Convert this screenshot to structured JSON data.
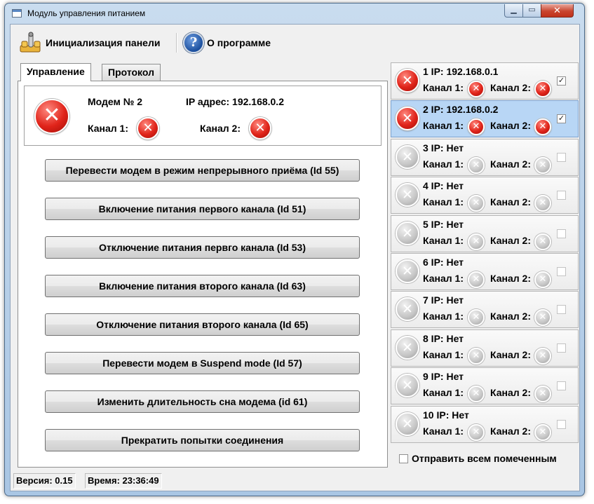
{
  "window": {
    "title": "Модуль управления питанием"
  },
  "toolbar": {
    "init_label": "Инициализация панели",
    "about_label": "О программе"
  },
  "tabs": [
    "Управление",
    "Протокол"
  ],
  "status": {
    "modem_label": "Модем № 2",
    "ip_label": "IP адрес: 192.168.0.2",
    "ch1_label": "Канал 1:",
    "ch2_label": "Канал 2:"
  },
  "buttons": [
    "Перевести модем в режим непрерывного приёма (Id 55)",
    "Включение питания первого канала (Id 51)",
    "Отключение питания первго канала (Id 53)",
    "Включение питания второго канала (Id 63)",
    "Отключение питания второго канала (Id 65)",
    "Перевести модем в Suspend mode (Id 57)",
    "Изменить длительность сна модема (id 61)",
    "Прекратить попытки соединения"
  ],
  "modems": [
    {
      "ip": "1 IP: 192.168.0.1",
      "state": "error",
      "checked": true,
      "selected": false
    },
    {
      "ip": "2 IP: 192.168.0.2",
      "state": "error",
      "checked": true,
      "selected": true
    },
    {
      "ip": "3 IP: Нет",
      "state": "off",
      "checked": false,
      "selected": false
    },
    {
      "ip": "4 IP: Нет",
      "state": "off",
      "checked": false,
      "selected": false
    },
    {
      "ip": "5 IP: Нет",
      "state": "off",
      "checked": false,
      "selected": false
    },
    {
      "ip": "6 IP: Нет",
      "state": "off",
      "checked": false,
      "selected": false
    },
    {
      "ip": "7 IP: Нет",
      "state": "off",
      "checked": false,
      "selected": false
    },
    {
      "ip": "8 IP: Нет",
      "state": "off",
      "checked": false,
      "selected": false
    },
    {
      "ip": "9 IP: Нет",
      "state": "off",
      "checked": false,
      "selected": false
    },
    {
      "ip": "10 IP: Нет",
      "state": "off",
      "checked": false,
      "selected": false
    }
  ],
  "channel_labels": {
    "ch1": "Канал 1:",
    "ch2": "Канал 2:"
  },
  "send_all_label": "Отправить всем помеченным",
  "statusbar": {
    "version": "Версия: 0.15",
    "time": "Время: 23:36:49"
  },
  "icons": {
    "close": "close-icon",
    "error": "error-icon",
    "off": "disabled-icon",
    "tool": "wrench-icon",
    "help": "help-icon"
  },
  "colors": {
    "error_red": "#e0241a",
    "selected_row": "#b8d6f5"
  }
}
